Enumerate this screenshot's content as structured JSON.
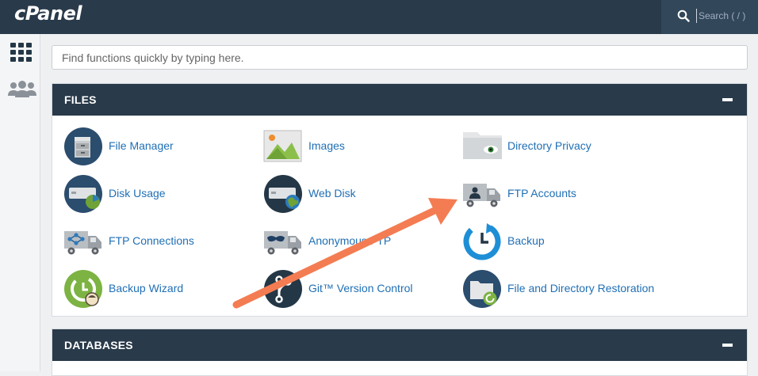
{
  "header": {
    "logo": "cPanel",
    "search_placeholder": "Search ( / )"
  },
  "sidebar": {
    "items": [
      {
        "name": "grid-icon"
      },
      {
        "name": "users-icon"
      }
    ]
  },
  "quick_find": {
    "placeholder": "Find functions quickly by typing here."
  },
  "files": {
    "title": "FILES",
    "items": [
      {
        "label": "File Manager",
        "icon": "file-manager-icon"
      },
      {
        "label": "Images",
        "icon": "images-icon"
      },
      {
        "label": "Directory Privacy",
        "icon": "directory-privacy-icon"
      },
      {
        "label": "Disk Usage",
        "icon": "disk-usage-icon"
      },
      {
        "label": "Web Disk",
        "icon": "web-disk-icon"
      },
      {
        "label": "FTP Accounts",
        "icon": "ftp-accounts-icon"
      },
      {
        "label": "FTP Connections",
        "icon": "ftp-connections-icon"
      },
      {
        "label": "Anonymous FTP",
        "icon": "anonymous-ftp-icon"
      },
      {
        "label": "Backup",
        "icon": "backup-icon"
      },
      {
        "label": "Backup Wizard",
        "icon": "backup-wizard-icon"
      },
      {
        "label": "Git™ Version Control",
        "icon": "git-icon"
      },
      {
        "label": "File and Directory Restoration",
        "icon": "file-restoration-icon"
      }
    ]
  },
  "databases": {
    "title": "DATABASES"
  },
  "annotation": {
    "color": "#f47c52",
    "points_to": "FTP Accounts"
  },
  "colors": {
    "header_bg": "#293a4a",
    "link": "#1f6fb5",
    "accent": "#f47c52"
  }
}
